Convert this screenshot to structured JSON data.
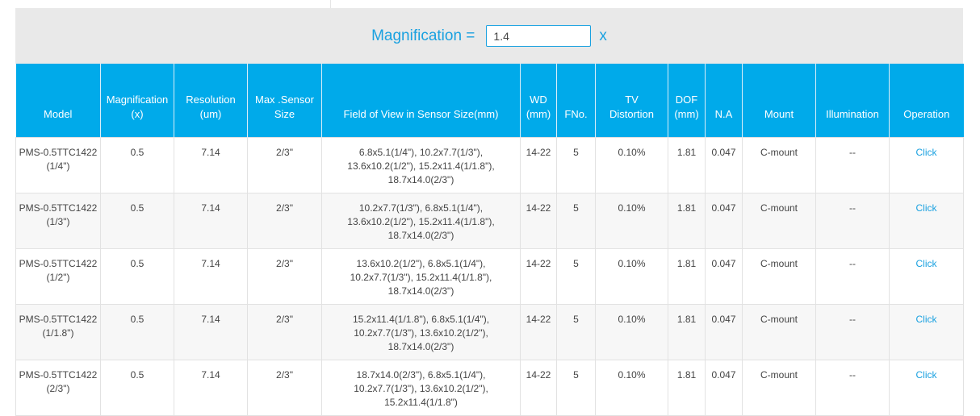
{
  "magnification": {
    "label": "Magnification =",
    "value": "1.4",
    "unit": "x"
  },
  "table": {
    "headers": [
      [
        "Model"
      ],
      [
        "Magnification",
        "(x)"
      ],
      [
        "Resolution",
        "(um)"
      ],
      [
        "Max .Sensor",
        "Size"
      ],
      [
        "Field of View in Sensor Size(mm)"
      ],
      [
        "WD",
        "(mm)"
      ],
      [
        "FNo."
      ],
      [
        "TV",
        "Distortion"
      ],
      [
        "DOF",
        "(mm)"
      ],
      [
        "N.A"
      ],
      [
        "Mount"
      ],
      [
        "Illumination"
      ],
      [
        "Operation"
      ]
    ],
    "rows": [
      {
        "model": [
          "PMS-0.5TTC1422",
          "(1/4\")"
        ],
        "mag": "0.5",
        "res": "7.14",
        "sensor": "2/3\"",
        "fov": [
          "6.8x5.1(1/4\"), 10.2x7.7(1/3\"),",
          "13.6x10.2(1/2\"), 15.2x11.4(1/1.8\"),",
          "18.7x14.0(2/3\")"
        ],
        "wd": "14-22",
        "fno": "5",
        "tv": "0.10%",
        "dof": "1.81",
        "na": "0.047",
        "mount": "C-mount",
        "illum": "--",
        "op": "Click"
      },
      {
        "model": [
          "PMS-0.5TTC1422",
          "(1/3\")"
        ],
        "mag": "0.5",
        "res": "7.14",
        "sensor": "2/3\"",
        "fov": [
          "10.2x7.7(1/3\"), 6.8x5.1(1/4\"),",
          "13.6x10.2(1/2\"), 15.2x11.4(1/1.8\"),",
          "18.7x14.0(2/3\")"
        ],
        "wd": "14-22",
        "fno": "5",
        "tv": "0.10%",
        "dof": "1.81",
        "na": "0.047",
        "mount": "C-mount",
        "illum": "--",
        "op": "Click"
      },
      {
        "model": [
          "PMS-0.5TTC1422",
          "(1/2\")"
        ],
        "mag": "0.5",
        "res": "7.14",
        "sensor": "2/3\"",
        "fov": [
          "13.6x10.2(1/2\"), 6.8x5.1(1/4\"),",
          "10.2x7.7(1/3\"), 15.2x11.4(1/1.8\"),",
          "18.7x14.0(2/3\")"
        ],
        "wd": "14-22",
        "fno": "5",
        "tv": "0.10%",
        "dof": "1.81",
        "na": "0.047",
        "mount": "C-mount",
        "illum": "--",
        "op": "Click"
      },
      {
        "model": [
          "PMS-0.5TTC1422",
          "(1/1.8\")"
        ],
        "mag": "0.5",
        "res": "7.14",
        "sensor": "2/3\"",
        "fov": [
          "15.2x11.4(1/1.8\"), 6.8x5.1(1/4\"),",
          "10.2x7.7(1/3\"), 13.6x10.2(1/2\"),",
          "18.7x14.0(2/3\")"
        ],
        "wd": "14-22",
        "fno": "5",
        "tv": "0.10%",
        "dof": "1.81",
        "na": "0.047",
        "mount": "C-mount",
        "illum": "--",
        "op": "Click"
      },
      {
        "model": [
          "PMS-0.5TTC1422",
          "(2/3\")"
        ],
        "mag": "0.5",
        "res": "7.14",
        "sensor": "2/3\"",
        "fov": [
          "18.7x14.0(2/3\"), 6.8x5.1(1/4\"),",
          "10.2x7.7(1/3\"), 13.6x10.2(1/2\"),",
          "15.2x11.4(1/1.8\")"
        ],
        "wd": "14-22",
        "fno": "5",
        "tv": "0.10%",
        "dof": "1.81",
        "na": "0.047",
        "mount": "C-mount",
        "illum": "--",
        "op": "Click"
      }
    ]
  }
}
